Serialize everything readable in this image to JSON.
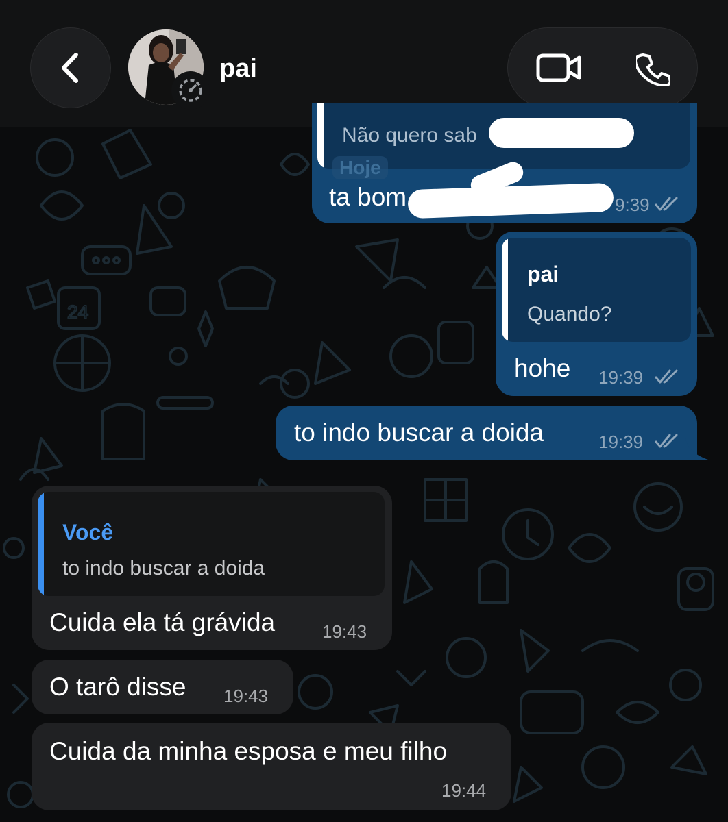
{
  "contact": {
    "name": "pai"
  },
  "messages": [
    {
      "direction": "outgoing",
      "quote_text": "Não quero sab",
      "date_chip": "Hoje",
      "text": "ta bom",
      "time": "9:39",
      "redacted": true
    },
    {
      "direction": "outgoing",
      "quote_author": "pai",
      "quote_text": "Quando?",
      "text": "hohe",
      "time": "19:39"
    },
    {
      "direction": "outgoing",
      "text": "to indo buscar a doida",
      "time": "19:39"
    },
    {
      "direction": "incoming",
      "quote_author": "Você",
      "quote_text": "to indo buscar a doida",
      "text": "Cuida ela tá grávida",
      "time": "19:43"
    },
    {
      "direction": "incoming",
      "text": "O tarô disse",
      "time": "19:43"
    },
    {
      "direction": "incoming",
      "text": "Cuida da minha esposa e meu filho",
      "time": "19:44"
    }
  ],
  "icons": {
    "back": "chevron-left-icon",
    "video": "video-camera-icon",
    "phone": "phone-icon",
    "status": "disappearing-timer-icon",
    "ticks": "double-check-icon"
  },
  "colors": {
    "background": "#0b0c0d",
    "header": "#121314",
    "outgoing_bubble": "#134774",
    "incoming_bubble": "#202123",
    "quote_accent_incoming": "#3a8ff0"
  }
}
